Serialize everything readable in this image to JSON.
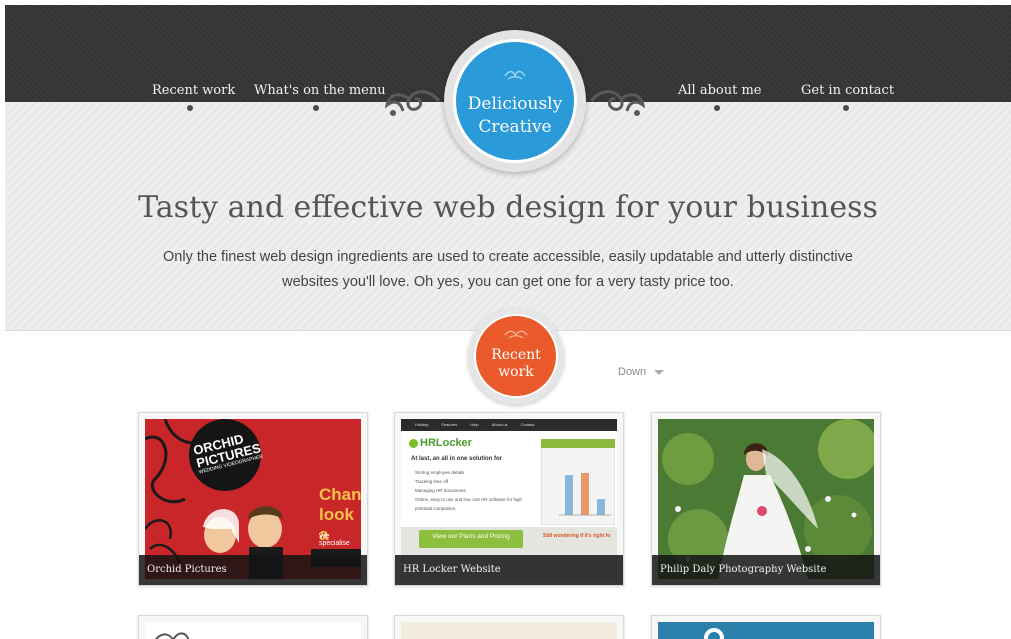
{
  "nav": {
    "left": [
      "Recent work",
      "What's on the menu"
    ],
    "right": [
      "All about me",
      "Get in contact"
    ]
  },
  "logo": {
    "line1": "Deliciously",
    "line2": "Creative"
  },
  "hero": {
    "title": "Tasty and effective web design for your business",
    "desc_line1": "Only the finest web design ingredients are used to create accessible, easily updatable and utterly distinctive",
    "desc_line2": "websites you'll love. Oh yes, you can get one for a very tasty price too."
  },
  "recent_work": {
    "line1": "Recent",
    "line2": "work",
    "down_label": "Down"
  },
  "cards": [
    {
      "caption": "Orchid Pictures",
      "thumb_title_1": "ORCHID",
      "thumb_title_2": "PICTURES",
      "thumb_sub": "WEDDING VIDEOGRAPHER",
      "thumb_headline_1": "Chan",
      "thumb_headline_2": "look a",
      "thumb_text": "We specialise"
    },
    {
      "caption": "HR Locker Website",
      "thumb_nav": [
        "Holiday",
        "Features",
        "Help",
        "About us",
        "Contact"
      ],
      "thumb_logo": "HRLocker",
      "thumb_lead": "At last, an all in one solution for",
      "thumb_items": [
        "Storing employee details",
        "Tracking time off",
        "Managing HR documents",
        "Online, easy to use and low cost HR software for high potential companies."
      ],
      "thumb_button": "View our Plans and Pricing",
      "thumb_side": "Still wondering if it's right fo"
    },
    {
      "caption": "Philip Daly Photography Website"
    }
  ],
  "colors": {
    "logo_blue": "#2b9ad8",
    "badge_orange": "#ea5a2a",
    "topbar_dark": "#363636"
  }
}
